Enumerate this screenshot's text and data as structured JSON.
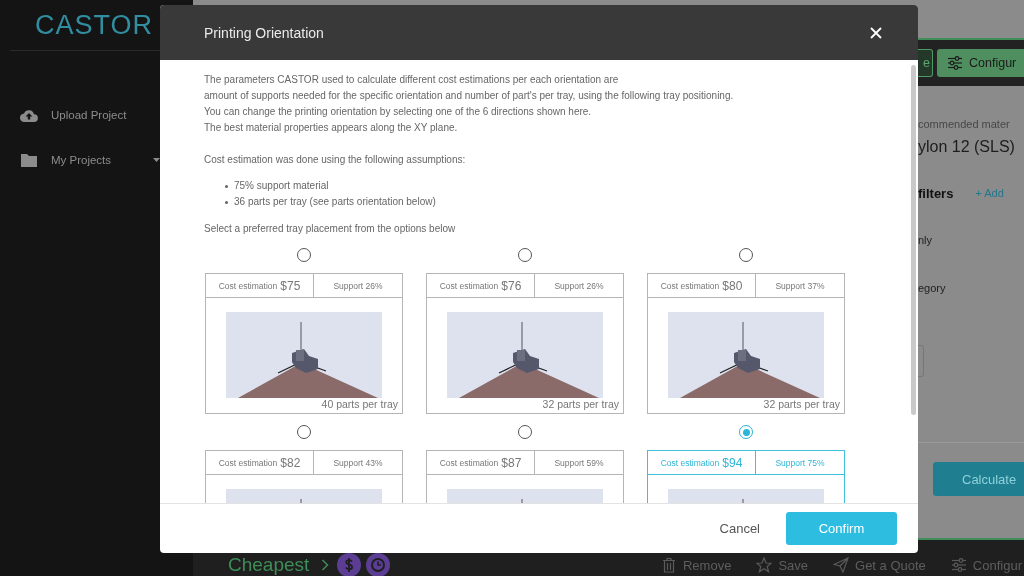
{
  "sidebar": {
    "logo": "CASTOR",
    "items": [
      {
        "label": "Upload Project",
        "kind": "link"
      },
      {
        "label": "My Projects",
        "kind": "menu"
      }
    ]
  },
  "page": {
    "toolbar_buttons": [
      {
        "label": "e",
        "kind": "outline"
      },
      {
        "label": "Configur",
        "kind": "filled"
      }
    ],
    "panel": {
      "subtitle": "commended mater",
      "material": "ylon 12 (SLS)",
      "filters_title": "filters",
      "add_link": "+ Add",
      "filter_labels": [
        "nly",
        "egory"
      ],
      "calculate": "Calculate"
    },
    "bottom_bar": {
      "title": "Cheapest",
      "actions": [
        "Remove",
        "Save",
        "Get a Quote",
        "Configur"
      ]
    }
  },
  "dialog": {
    "title": "Printing Orientation",
    "intro": [
      "The parameters CASTOR used to calculate different cost estimations per each orientation are",
      "amount of supports needed for the specific orientation and number of part's per tray, using the following tray positioning.",
      "You can change the printing orientation by selecting one of the 6 directions shown here.",
      "The best material properties appears along the XY plane."
    ],
    "assumptions_title": "Cost estimation was done using the following assumptions:",
    "assumptions": [
      "75% support material",
      "36 parts per tray (see parts orientation below)"
    ],
    "prompt": "Select a preferred tray placement from the options below",
    "options": [
      {
        "cost_label": "Cost estimation",
        "cost": "$75",
        "support": "Support 26%",
        "parts": "40 parts per tray",
        "selected": false
      },
      {
        "cost_label": "Cost estimation",
        "cost": "$76",
        "support": "Support 26%",
        "parts": "32 parts per tray",
        "selected": false
      },
      {
        "cost_label": "Cost estimation",
        "cost": "$80",
        "support": "Support 37%",
        "parts": "32 parts per tray",
        "selected": false
      },
      {
        "cost_label": "Cost estimation",
        "cost": "$82",
        "support": "Support 43%",
        "selected": false
      },
      {
        "cost_label": "Cost estimation",
        "cost": "$87",
        "support": "Support 59%",
        "selected": false
      },
      {
        "cost_label": "Cost estimation",
        "cost": "$94",
        "support": "Support 75%",
        "selected": true
      }
    ],
    "buttons": [
      {
        "label": "Cancel",
        "kind": "text"
      },
      {
        "label": "Confirm",
        "kind": "primary"
      }
    ]
  }
}
